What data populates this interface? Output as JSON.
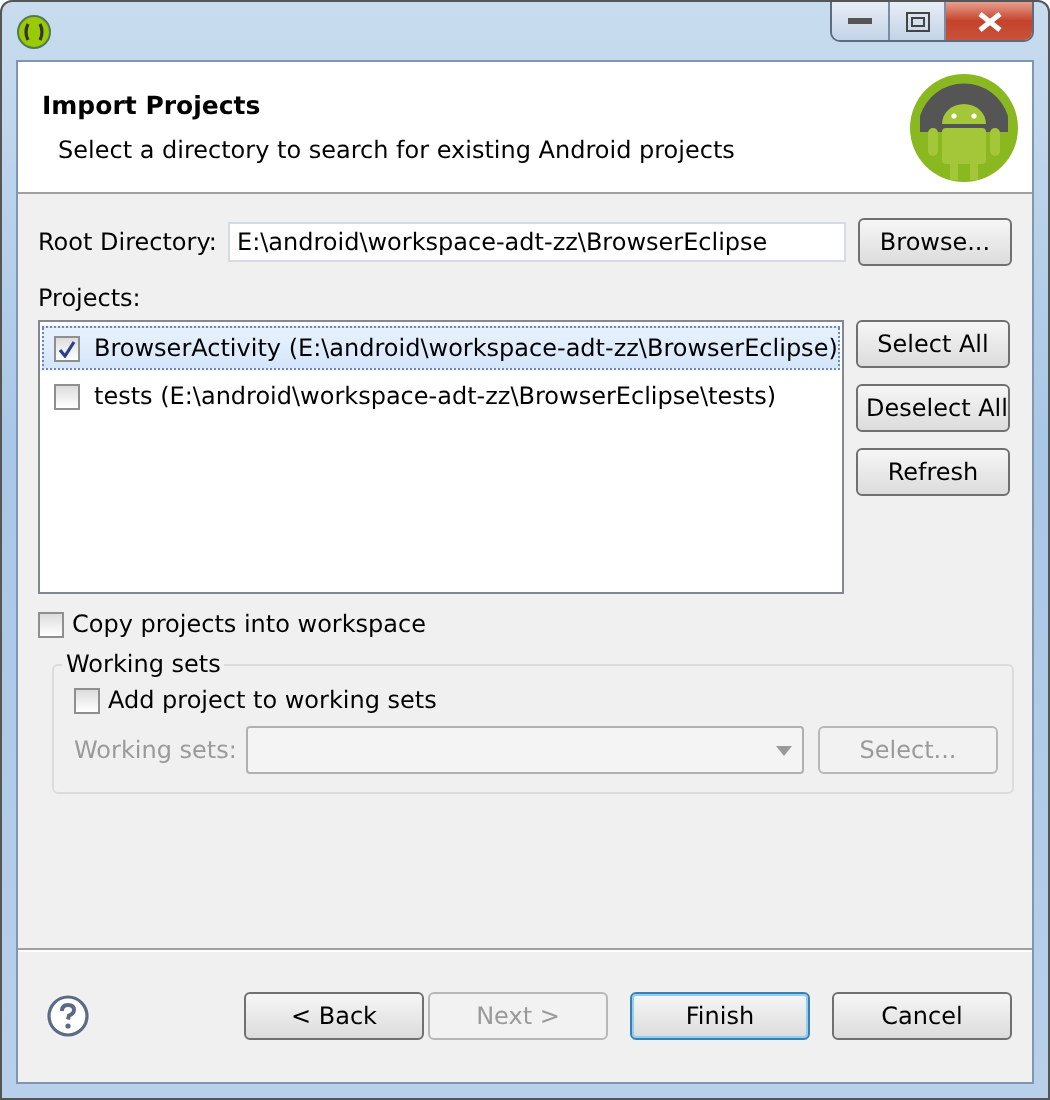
{
  "header": {
    "title": "Import Projects",
    "description": "Select a directory to search for existing Android projects"
  },
  "root_directory": {
    "label": "Root Directory:",
    "value": "E:\\android\\workspace-adt-zz\\BrowserEclipse",
    "button": "Browse..."
  },
  "projects": {
    "label": "Projects:",
    "items": [
      {
        "label": "BrowserActivity (E:\\android\\workspace-adt-zz\\BrowserEclipse)",
        "checked": true,
        "selected": true
      },
      {
        "label": "tests (E:\\android\\workspace-adt-zz\\BrowserEclipse\\tests)",
        "checked": false,
        "selected": false
      }
    ],
    "buttons": [
      "Select All",
      "Deselect All",
      "Refresh"
    ]
  },
  "copy_option": {
    "label": "Copy projects into workspace",
    "checked": false
  },
  "working_sets": {
    "title": "Working sets",
    "add_option": {
      "label": "Add project to working sets",
      "checked": false
    },
    "label": "Working sets:",
    "disabled": true,
    "button": "Select..."
  },
  "footer_buttons": [
    {
      "label": "< Back",
      "disabled": false,
      "default": false
    },
    {
      "label": "Next >",
      "disabled": true,
      "default": false
    },
    {
      "label": "Finish",
      "disabled": false,
      "default": true
    },
    {
      "label": "Cancel",
      "disabled": false,
      "default": false
    }
  ]
}
